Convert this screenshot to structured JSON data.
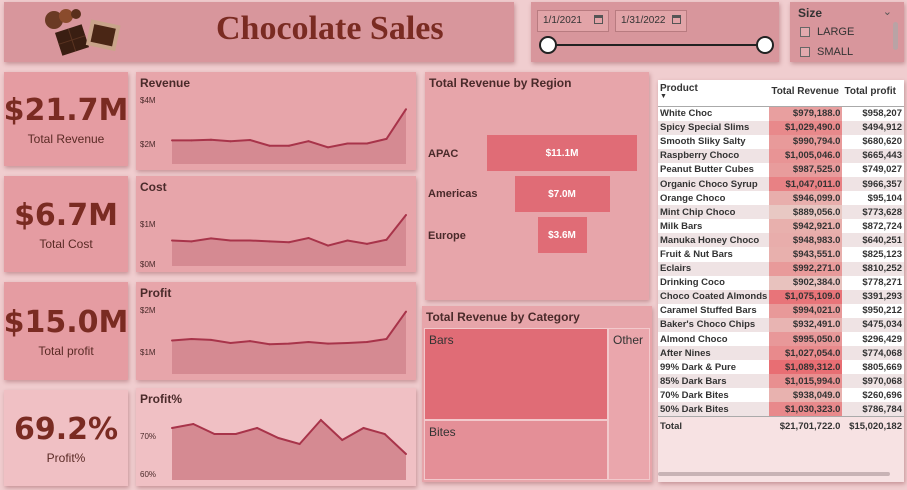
{
  "header": {
    "title": "Chocolate Sales",
    "logo_icon": "chocolate-bars-icon"
  },
  "date_filter": {
    "start": "1/1/2021",
    "end": "1/31/2022",
    "calendar_icon": "calendar-icon"
  },
  "size_filter": {
    "title": "Size",
    "options": [
      "LARGE",
      "SMALL"
    ],
    "chevron_icon": "chevron-down-icon"
  },
  "kpis": [
    {
      "value": "$21.7M",
      "label": "Total Revenue"
    },
    {
      "value": "$6.7M",
      "label": "Total Cost"
    },
    {
      "value": "$15.0M",
      "label": "Total profit"
    },
    {
      "value": "69.2%",
      "label": "Profit%"
    }
  ],
  "colors": {
    "accent": "#e06c76",
    "line": "#a8344a",
    "area": "#d58a92",
    "title": "#7a2b22"
  },
  "chart_data": [
    {
      "type": "area",
      "title": "Revenue",
      "yticks": [
        "$4M",
        "$2M"
      ],
      "ylim": [
        0,
        4.6
      ],
      "tick_values": [
        4,
        2
      ],
      "values": [
        1.55,
        1.55,
        1.6,
        1.5,
        1.58,
        1.2,
        1.2,
        1.5,
        1.1,
        1.35,
        1.35,
        1.65,
        3.6
      ]
    },
    {
      "type": "area",
      "title": "Cost",
      "yticks": [
        "$1M",
        "$0M"
      ],
      "ylim": [
        -0.1,
        1.5
      ],
      "tick_values": [
        1,
        0
      ],
      "values": [
        0.5,
        0.48,
        0.55,
        0.5,
        0.5,
        0.48,
        0.46,
        0.56,
        0.38,
        0.5,
        0.42,
        0.52,
        1.1
      ]
    },
    {
      "type": "area",
      "title": "Profit",
      "yticks": [
        "$2M",
        "$1M"
      ],
      "ylim": [
        0,
        2.3
      ],
      "tick_values": [
        2,
        1
      ],
      "values": [
        1.1,
        1.15,
        1.12,
        1.02,
        1.08,
        0.98,
        1.0,
        1.05,
        1.0,
        1.02,
        1.05,
        1.15,
        2.05
      ]
    },
    {
      "type": "area",
      "title": "Profit%",
      "yticks": [
        "70%",
        "60%"
      ],
      "ylim": [
        58,
        75.5
      ],
      "tick_values": [
        70,
        60
      ],
      "values": [
        71,
        72,
        69.5,
        69.5,
        71,
        68.5,
        67,
        73,
        68,
        71,
        69.5,
        64.5
      ]
    },
    {
      "type": "bar",
      "title": "Total Revenue by Region",
      "categories": [
        "APAC",
        "Americas",
        "Europe"
      ],
      "values": [
        11.1,
        7.0,
        3.6
      ],
      "labels": [
        "$11.1M",
        "$7.0M",
        "$3.6M"
      ]
    },
    {
      "type": "heatmap",
      "title": "Total Revenue by Category",
      "categories": [
        "Bars",
        "Bites",
        "Other"
      ]
    }
  ],
  "table": {
    "headers": [
      "Product",
      "Total Revenue",
      "Total profit"
    ],
    "rows": [
      [
        "White Choc",
        "$979,188.0",
        "$958,207"
      ],
      [
        "Spicy Special Slims",
        "$1,029,490.0",
        "$494,912"
      ],
      [
        "Smooth Sliky Salty",
        "$990,794.0",
        "$680,620"
      ],
      [
        "Raspberry Choco",
        "$1,005,046.0",
        "$665,443"
      ],
      [
        "Peanut Butter Cubes",
        "$987,525.0",
        "$749,027"
      ],
      [
        "Organic Choco Syrup",
        "$1,047,011.0",
        "$966,357"
      ],
      [
        "Orange Choco",
        "$946,099.0",
        "$95,104"
      ],
      [
        "Mint Chip Choco",
        "$889,056.0",
        "$773,628"
      ],
      [
        "Milk Bars",
        "$942,921.0",
        "$872,724"
      ],
      [
        "Manuka Honey Choco",
        "$948,983.0",
        "$640,251"
      ],
      [
        "Fruit & Nut Bars",
        "$943,551.0",
        "$825,123"
      ],
      [
        "Eclairs",
        "$992,271.0",
        "$810,252"
      ],
      [
        "Drinking Coco",
        "$902,384.0",
        "$778,271"
      ],
      [
        "Choco Coated Almonds",
        "$1,075,109.0",
        "$391,293"
      ],
      [
        "Caramel Stuffed Bars",
        "$994,021.0",
        "$950,212"
      ],
      [
        "Baker's Choco Chips",
        "$932,491.0",
        "$475,034"
      ],
      [
        "Almond Choco",
        "$995,050.0",
        "$296,429"
      ],
      [
        "After Nines",
        "$1,027,054.0",
        "$774,068"
      ],
      [
        "99% Dark & Pure",
        "$1,089,312.0",
        "$805,669"
      ],
      [
        "85% Dark Bars",
        "$1,015,994.0",
        "$970,068"
      ],
      [
        "70% Dark Bites",
        "$938,049.0",
        "$260,696"
      ],
      [
        "50% Dark Bites",
        "$1,030,323.0",
        "$786,784"
      ]
    ],
    "total": [
      "Total",
      "$21,701,722.0",
      "$15,020,182"
    ]
  }
}
